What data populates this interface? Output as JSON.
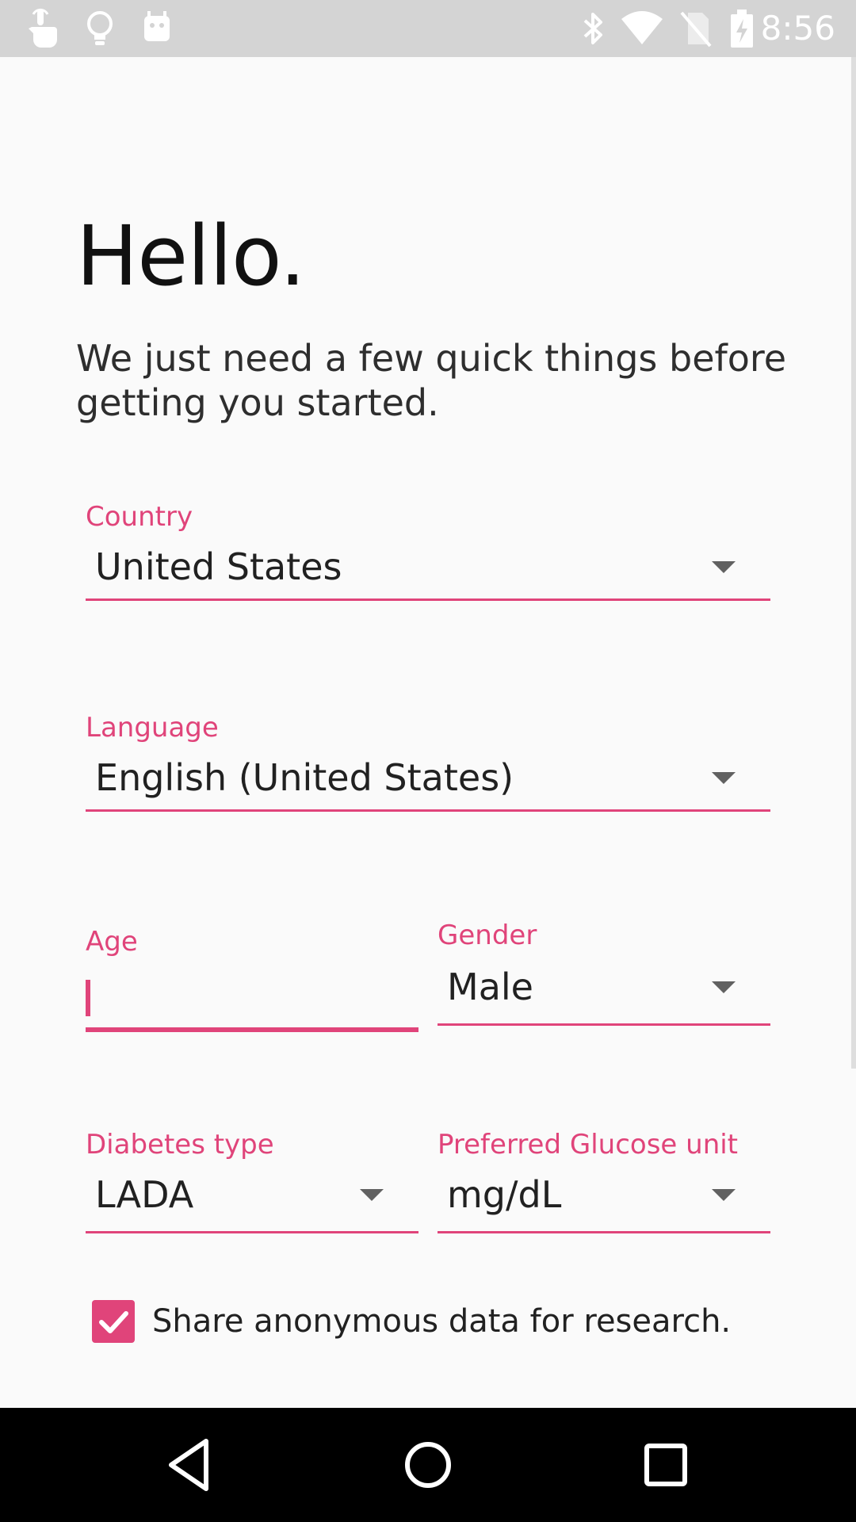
{
  "status_bar": {
    "time": "8:56",
    "left_icons": [
      "touch-icon",
      "lightbulb-icon",
      "android-icon"
    ],
    "right_icons": [
      "bluetooth-icon",
      "wifi-icon",
      "no-sim-icon",
      "battery-charging-icon"
    ]
  },
  "page": {
    "title": "Hello.",
    "subtitle": "We just need a few quick things before getting you started."
  },
  "form": {
    "country": {
      "label": "Country",
      "value": "United States"
    },
    "language": {
      "label": "Language",
      "value": "English (United States)"
    },
    "age": {
      "label": "Age",
      "value": ""
    },
    "gender": {
      "label": "Gender",
      "value": "Male"
    },
    "diabetes_type": {
      "label": "Diabetes type",
      "value": "LADA"
    },
    "glucose_unit": {
      "label": "Preferred Glucose unit",
      "value": "mg/dL"
    },
    "share_data": {
      "label": "Share anonymous data for research.",
      "checked": true
    }
  },
  "nav_bar": {
    "buttons": [
      "back-icon",
      "home-icon",
      "recents-icon"
    ]
  },
  "colors": {
    "accent": "#e0447a",
    "status_bar": "#d4d4d4",
    "background": "#fafafa",
    "nav_bar": "#000000"
  }
}
